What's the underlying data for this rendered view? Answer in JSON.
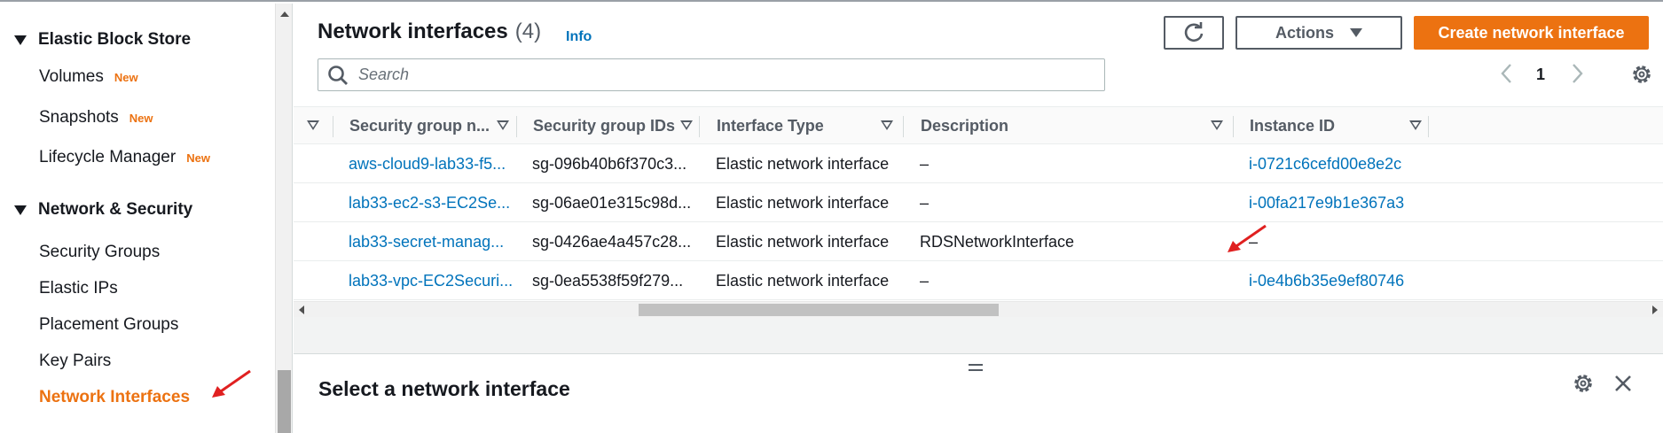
{
  "sidebar": {
    "sections": [
      {
        "label": "Elastic Block Store"
      },
      {
        "label": "Network & Security"
      }
    ],
    "ebs_items": [
      {
        "label": "Volumes",
        "badge": "New"
      },
      {
        "label": "Snapshots",
        "badge": "New"
      },
      {
        "label": "Lifecycle Manager",
        "badge": "New"
      }
    ],
    "net_items": [
      {
        "label": "Security Groups"
      },
      {
        "label": "Elastic IPs"
      },
      {
        "label": "Placement Groups"
      },
      {
        "label": "Key Pairs"
      },
      {
        "label": "Network Interfaces",
        "active": true
      }
    ]
  },
  "header": {
    "title": "Network interfaces",
    "count": "(4)",
    "info": "Info",
    "actions_label": "Actions",
    "create_label": "Create network interface"
  },
  "search": {
    "placeholder": "Search"
  },
  "pagination": {
    "page": "1"
  },
  "table": {
    "columns": [
      "Security group n...",
      "Security group IDs",
      "Interface Type",
      "Description",
      "Instance ID"
    ],
    "rows": [
      {
        "sg_name": "aws-cloud9-lab33-f5...",
        "sg_ids": "sg-096b40b6f370c3...",
        "type": "Elastic network interface",
        "description": "–",
        "instance": "i-0721c6cefd00e8e2c"
      },
      {
        "sg_name": "lab33-ec2-s3-EC2Se...",
        "sg_ids": "sg-06ae01e315c98d...",
        "type": "Elastic network interface",
        "description": "–",
        "instance": "i-00fa217e9b1e367a3"
      },
      {
        "sg_name": "lab33-secret-manag...",
        "sg_ids": "sg-0426ae4a457c28...",
        "type": "Elastic network interface",
        "description": "RDSNetworkInterface",
        "instance": "–"
      },
      {
        "sg_name": "lab33-vpc-EC2Securi...",
        "sg_ids": "sg-0ea5538f59f279...",
        "type": "Elastic network interface",
        "description": "–",
        "instance": "i-0e4b6b35e9ef80746"
      }
    ]
  },
  "detail": {
    "title": "Select a network interface"
  },
  "colors": {
    "accent": "#ec7211",
    "link": "#0073bb",
    "annotation": "#e02020"
  }
}
